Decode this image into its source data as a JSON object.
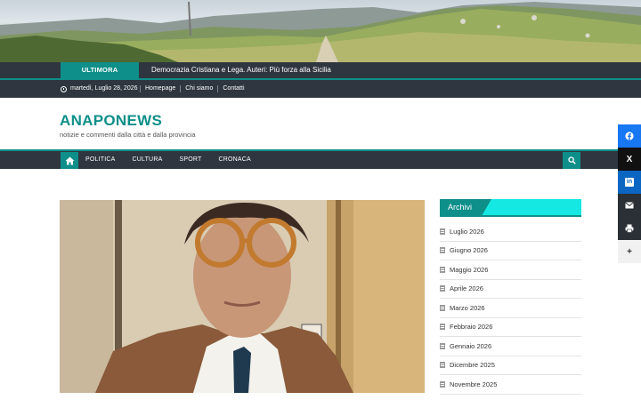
{
  "ticker": {
    "label": "ULTIMORA",
    "headline": "Democrazia Cristiana e Lega. Auteri: Più forza alla Sicilia"
  },
  "topbar": {
    "date": "martedì, Luglio 28, 2026",
    "links": [
      "Homepage",
      "Chi siamo",
      "Contatti"
    ]
  },
  "site": {
    "title": "ANAPONEWS",
    "description": "notizie e commenti dalla città e dalla provincia"
  },
  "nav": {
    "items": [
      "POLITICA",
      "CULTURA",
      "SPORT",
      "CRONACA"
    ],
    "home_icon": "home-icon",
    "search_icon": "search-icon"
  },
  "sidebar": {
    "widget_title": "Archivi",
    "archives": [
      "Luglio 2026",
      "Giugno 2026",
      "Maggio 2026",
      "Aprile 2026",
      "Marzo 2026",
      "Febbraio 2026",
      "Gennaio 2026",
      "Dicembre 2025",
      "Novembre 2025"
    ]
  },
  "share": {
    "icons": [
      "facebook-icon",
      "x-icon",
      "linkedin-icon",
      "email-icon",
      "print-icon",
      "plus-icon"
    ],
    "x_glyph": "X",
    "linkedin_glyph": "in",
    "plus_glyph": "+"
  },
  "colors": {
    "accent": "#0e8f89",
    "accent_light": "#15e8e3",
    "dark_bar": "#2f3640"
  }
}
